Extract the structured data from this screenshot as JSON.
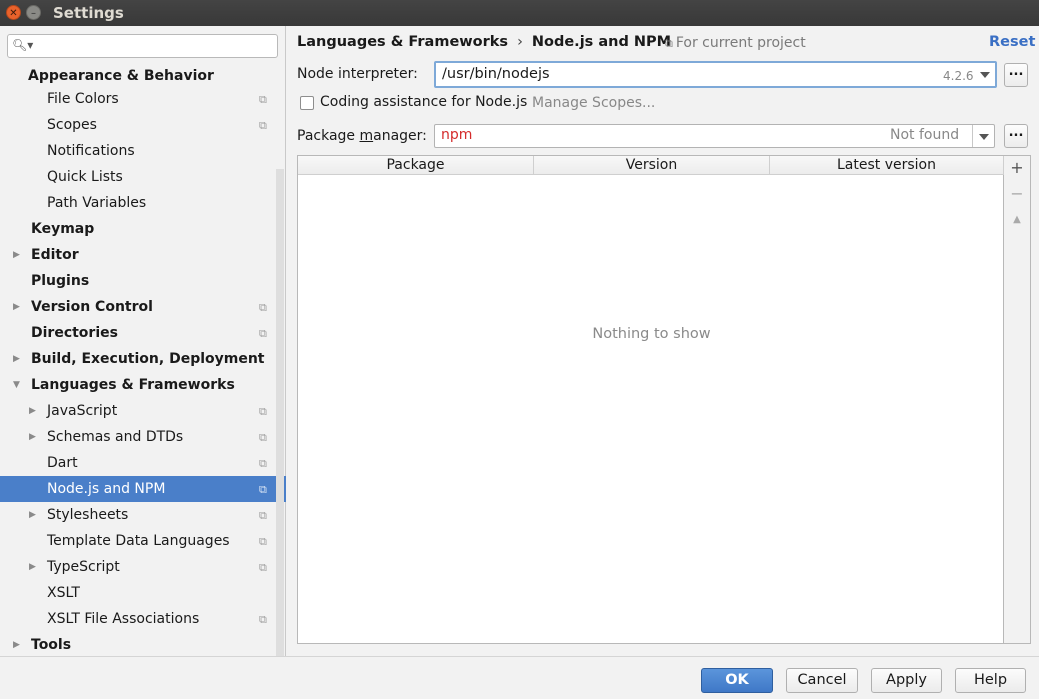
{
  "window": {
    "title": "Settings"
  },
  "sidebar": {
    "search_value": "",
    "items": [
      {
        "label": "Appearance & Behavior",
        "bold": true,
        "indent": 0,
        "arrow": "",
        "project_icon": false,
        "selected": false
      },
      {
        "label": "File Colors",
        "bold": false,
        "indent": 1,
        "arrow": "",
        "project_icon": true,
        "selected": false
      },
      {
        "label": "Scopes",
        "bold": false,
        "indent": 1,
        "arrow": "",
        "project_icon": true,
        "selected": false
      },
      {
        "label": "Notifications",
        "bold": false,
        "indent": 1,
        "arrow": "",
        "project_icon": false,
        "selected": false
      },
      {
        "label": "Quick Lists",
        "bold": false,
        "indent": 1,
        "arrow": "",
        "project_icon": false,
        "selected": false
      },
      {
        "label": "Path Variables",
        "bold": false,
        "indent": 1,
        "arrow": "",
        "project_icon": false,
        "selected": false
      },
      {
        "label": "Keymap",
        "bold": true,
        "indent": 0,
        "arrow": "",
        "project_icon": false,
        "selected": false
      },
      {
        "label": "Editor",
        "bold": true,
        "indent": 0,
        "arrow": "collapsed",
        "project_icon": false,
        "selected": false
      },
      {
        "label": "Plugins",
        "bold": true,
        "indent": 0,
        "arrow": "",
        "project_icon": false,
        "selected": false
      },
      {
        "label": "Version Control",
        "bold": true,
        "indent": 0,
        "arrow": "collapsed",
        "project_icon": true,
        "selected": false
      },
      {
        "label": "Directories",
        "bold": true,
        "indent": 0,
        "arrow": "",
        "project_icon": true,
        "selected": false
      },
      {
        "label": "Build, Execution, Deployment",
        "bold": true,
        "indent": 0,
        "arrow": "collapsed",
        "project_icon": false,
        "selected": false
      },
      {
        "label": "Languages & Frameworks",
        "bold": true,
        "indent": 0,
        "arrow": "expanded",
        "project_icon": false,
        "selected": false
      },
      {
        "label": "JavaScript",
        "bold": false,
        "indent": 1,
        "arrow": "collapsed",
        "project_icon": true,
        "selected": false
      },
      {
        "label": "Schemas and DTDs",
        "bold": false,
        "indent": 1,
        "arrow": "collapsed",
        "project_icon": true,
        "selected": false
      },
      {
        "label": "Dart",
        "bold": false,
        "indent": 1,
        "arrow": "",
        "project_icon": true,
        "selected": false
      },
      {
        "label": "Node.js and NPM",
        "bold": false,
        "indent": 1,
        "arrow": "",
        "project_icon": true,
        "selected": true
      },
      {
        "label": "Stylesheets",
        "bold": false,
        "indent": 1,
        "arrow": "collapsed",
        "project_icon": true,
        "selected": false
      },
      {
        "label": "Template Data Languages",
        "bold": false,
        "indent": 1,
        "arrow": "",
        "project_icon": true,
        "selected": false
      },
      {
        "label": "TypeScript",
        "bold": false,
        "indent": 1,
        "arrow": "collapsed",
        "project_icon": true,
        "selected": false
      },
      {
        "label": "XSLT",
        "bold": false,
        "indent": 1,
        "arrow": "",
        "project_icon": false,
        "selected": false
      },
      {
        "label": "XSLT File Associations",
        "bold": false,
        "indent": 1,
        "arrow": "",
        "project_icon": true,
        "selected": false
      },
      {
        "label": "Tools",
        "bold": true,
        "indent": 0,
        "arrow": "collapsed",
        "project_icon": false,
        "selected": false
      }
    ]
  },
  "main": {
    "breadcrumb": {
      "parent": "Languages & Frameworks",
      "separator": "›",
      "current": "Node.js and NPM"
    },
    "scope_note": "For current project",
    "reset_label": "Reset",
    "node_interpreter": {
      "label": "Node interpreter:",
      "value": "/usr/bin/nodejs",
      "version": "4.2.6",
      "browse_label": "..."
    },
    "coding_assistance": {
      "label": "Coding assistance for Node.js",
      "checked": false,
      "manage_label": "Manage Scopes..."
    },
    "package_manager": {
      "label_prefix": "Package ",
      "label_underlined": "m",
      "label_suffix": "anager:",
      "value": "npm",
      "status": "Not found",
      "browse_label": "..."
    },
    "table": {
      "columns": [
        "Package",
        "Version",
        "Latest version"
      ],
      "rows": [],
      "empty_text": "Nothing to show"
    },
    "table_toolbar": {
      "add": "+",
      "remove": "−",
      "upgrade": "▲"
    }
  },
  "footer": {
    "ok": "OK",
    "cancel": "Cancel",
    "apply": "Apply",
    "help": "Help"
  },
  "colors": {
    "accent": "#4a7fc9",
    "error": "#d42a2a",
    "link": "#3a6fc4"
  }
}
